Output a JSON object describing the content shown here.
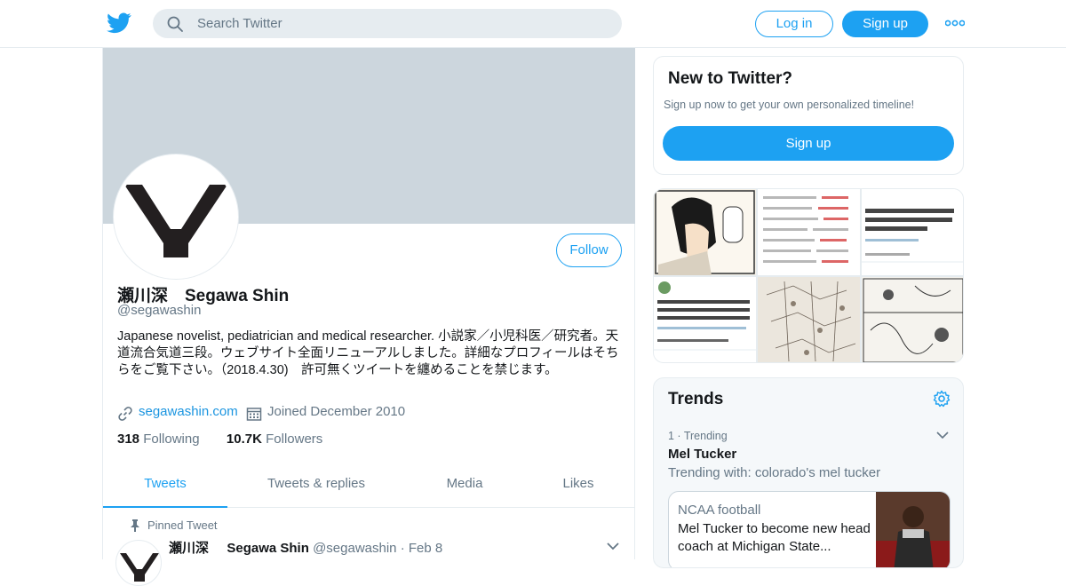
{
  "topbar": {
    "search_placeholder": "Search Twitter",
    "login_label": "Log in",
    "signup_label": "Sign up",
    "brand_color": "#1da1f2"
  },
  "profile": {
    "follow_label": "Follow",
    "display_name": "瀬川深　Segawa Shin",
    "handle": "@segawashin",
    "bio": "Japanese novelist, pediatrician and medical researcher.  小説家／小児科医／研究者。天道流合気道三段。ウェブサイト全面リニューアルしました。詳細なプロフィールはそちらをご覧下さい。（2018.4.30)　許可無くツイートを纏めることを禁じます。",
    "website": "segawashin.com",
    "joined": "Joined December 2010",
    "following_count": "318",
    "following_label": "Following",
    "followers_count": "10.7K",
    "followers_label": "Followers"
  },
  "tabs": [
    "Tweets",
    "Tweets & replies",
    "Media",
    "Likes"
  ],
  "pinned_tweet": {
    "pinned_label": "Pinned Tweet",
    "author_name": "瀬川深",
    "author_name_en": "Segawa Shin",
    "author_handle": "@segawashin",
    "date": "Feb 8"
  },
  "new_to_twitter": {
    "title": "New to Twitter?",
    "subtitle": "Sign up now to get your own personalized timeline!",
    "button": "Sign up"
  },
  "trends": {
    "title": "Trends",
    "items": [
      {
        "rank": "1",
        "context": "Trending",
        "name": "Mel Tucker",
        "trending_with": "Trending with: colorado's mel tucker",
        "news_category": "NCAA football",
        "news_title": "Mel Tucker to become new head coach at Michigan State..."
      }
    ]
  }
}
